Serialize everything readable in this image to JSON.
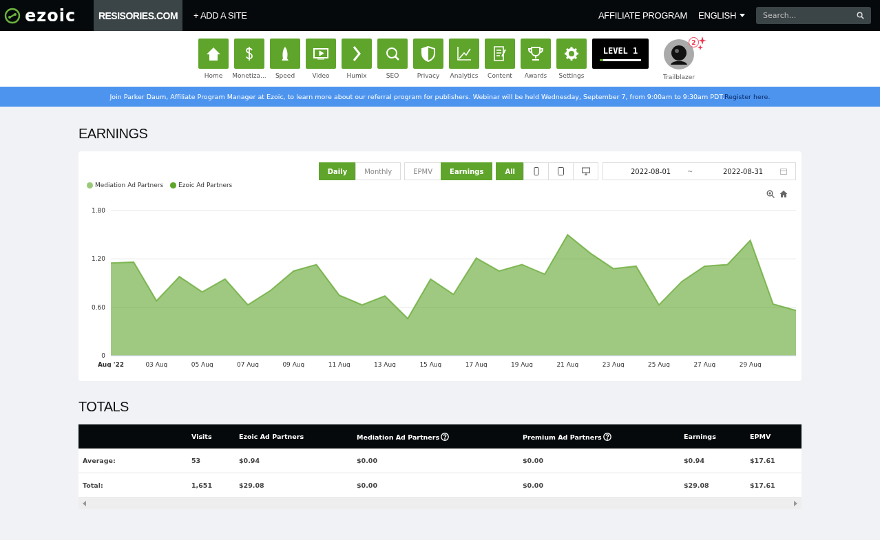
{
  "topbar": {
    "logo": "ezoic",
    "site": "RESISORIES.COM",
    "add_site": "+ ADD A SITE",
    "affiliate": "AFFILIATE PROGRAM",
    "language": "ENGLISH",
    "search": {
      "placeholder": "Search..."
    }
  },
  "apps": [
    {
      "kind": "home",
      "label": "Home"
    },
    {
      "kind": "dollar",
      "label": "Monetiza..."
    },
    {
      "kind": "rocket",
      "label": "Speed"
    },
    {
      "kind": "video",
      "label": "Video"
    },
    {
      "kind": "chevron",
      "label": "Humix"
    },
    {
      "kind": "search",
      "label": "SEO"
    },
    {
      "kind": "shield",
      "label": "Privacy"
    },
    {
      "kind": "chart",
      "label": "Analytics"
    },
    {
      "kind": "document",
      "label": "Content"
    },
    {
      "kind": "trophy",
      "label": "Awards"
    },
    {
      "kind": "gear",
      "label": "Settings"
    }
  ],
  "level": {
    "label": "LEVEL 1",
    "level": 0.08
  },
  "profile": {
    "label": "Trailblazer",
    "badge": "2"
  },
  "banner": {
    "text": "Join Parker Daum, Affiliate Program Manager at Ezoic, to learn more about our referral program for publishers. Webinar will be held Wednesday, September 7, from 9:00am to 9:30am PDT.",
    "link": "Register here."
  },
  "earnings": {
    "title": "EARNINGS",
    "period": [
      {
        "label": "Daily",
        "selected": true
      },
      {
        "label": "Monthly",
        "selected": false
      }
    ],
    "metric": [
      {
        "label": "EPMV",
        "selected": false
      },
      {
        "label": "Earnings",
        "selected": true
      }
    ],
    "device": [
      {
        "kind": "all",
        "label": "All",
        "selected": true
      },
      {
        "kind": "phone",
        "selected": false
      },
      {
        "kind": "tablet",
        "selected": false
      },
      {
        "kind": "desktop",
        "selected": false
      }
    ],
    "date_from": "2022-08-01",
    "date_sep": "~",
    "date_to": "2022-08-31",
    "legend": [
      {
        "label": "Mediation Ad Partners",
        "color": "#9bc97a"
      }
    ],
    "chart_data": {
      "type": "area",
      "categories": [
        "Aug '22",
        null,
        "03 Aug",
        null,
        "05 Aug",
        null,
        "07 Aug",
        null,
        "09 Aug",
        null,
        "11 Aug",
        null,
        "13 Aug",
        null,
        "15 Aug",
        null,
        "17 Aug",
        null,
        "19 Aug",
        null,
        "21 Aug",
        null,
        "23 Aug",
        null,
        "25 Aug",
        null,
        "27 Aug",
        null,
        "29 Aug",
        null,
        null
      ],
      "ylim": [
        0,
        1.8
      ],
      "yticks": [
        {
          "value": 0,
          "label": "0"
        },
        {
          "value": 0.6,
          "label": "0.60"
        },
        {
          "value": 1.2,
          "label": "1.20"
        },
        {
          "value": 1.8,
          "label": "1.80"
        }
      ],
      "series": [
        {
          "name": "Ezoic Ad Partners",
          "color": "#5fa52b",
          "values": [
            1.15,
            1.16,
            0.68,
            0.98,
            0.79,
            0.95,
            0.63,
            0.81,
            1.05,
            1.13,
            0.75,
            0.63,
            0.74,
            0.46,
            0.95,
            0.76,
            1.21,
            1.05,
            1.13,
            1.01,
            1.5,
            1.27,
            1.08,
            1.11,
            0.63,
            0.92,
            1.11,
            1.13,
            1.43,
            0.64,
            0.56
          ]
        }
      ]
    }
  },
  "totals": {
    "title": "TOTALS",
    "columns": [
      {
        "label": "Visits"
      },
      {
        "label": "Ezoic Ad Partners"
      },
      {
        "label": "Mediation Ad Partners",
        "help": true
      },
      {
        "label": "Premium Ad Partners",
        "help": true
      },
      {
        "label": "Earnings"
      },
      {
        "label": "EPMV"
      }
    ],
    "rows": [
      {
        "label": "Average:",
        "cells": [
          "53",
          "$0.94",
          "$0.00",
          "$0.00",
          "$0.94",
          "$17.61"
        ]
      },
      {
        "label": "Total:",
        "cells": [
          "1,651",
          "$29.08",
          "$0.00",
          "$0.00",
          "$29.08",
          "$17.61"
        ]
      }
    ]
  }
}
